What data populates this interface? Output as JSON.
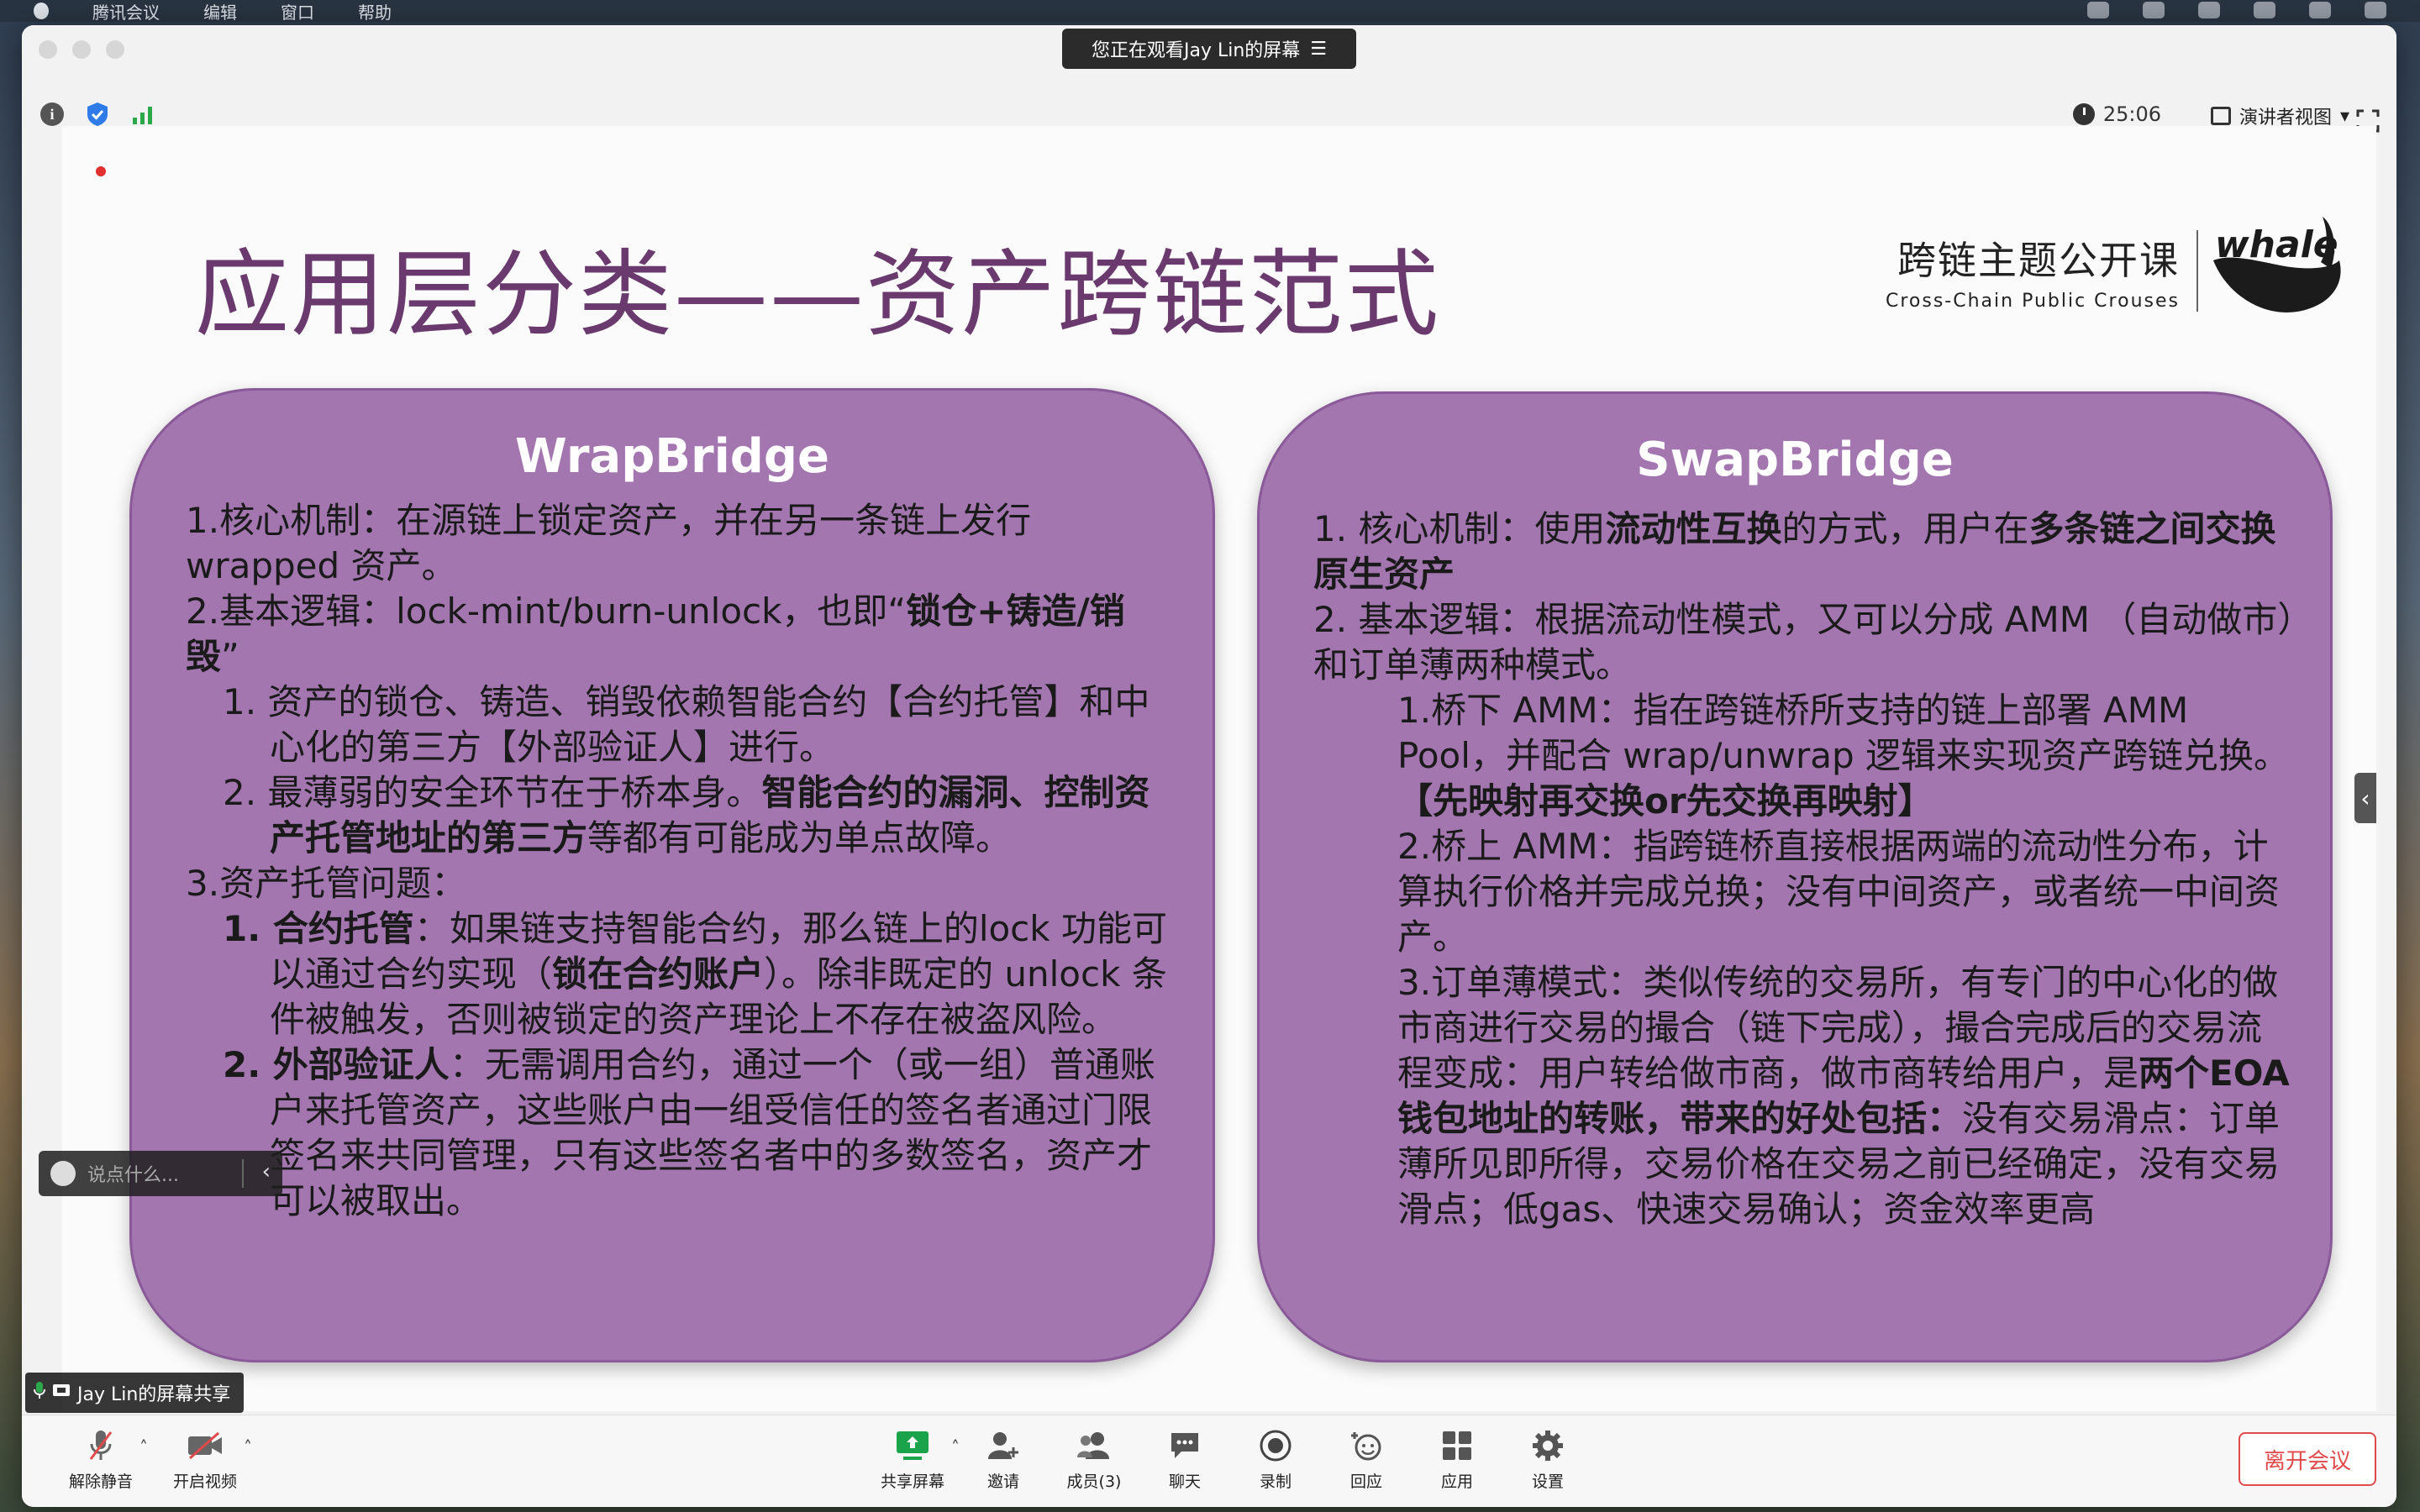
{
  "menubar": {
    "items": [
      "腾讯会议",
      "编辑",
      "窗口",
      "帮助"
    ]
  },
  "titlebar": {
    "watching_label": "您正在观看Jay Lin的屏幕"
  },
  "topbar": {
    "timer": "25:06",
    "view_mode": "演讲者视图"
  },
  "slide": {
    "title": "应用层分类——资产跨链范式",
    "brand_cn": "跨链主题公开课",
    "brand_en": "Cross-Chain Public Crouses",
    "logo_text": "whale",
    "left": {
      "title": "WrapBridge",
      "l1": "1.核心机制：在源链上锁定资产，并在另一条链上发行wrapped 资产。",
      "l2a": "2.基本逻辑：lock-mint/burn-unlock，也即“",
      "l2b": "锁仓+铸造/销毁",
      "l2c": "”",
      "l3": "1.  资产的锁仓、铸造、销毁依赖智能合约【合约托管】和中心化的第三方【外部验证人】进行。",
      "l4a": "2.  最薄弱的安全环节在于桥本身。",
      "l4b": "智能合约的漏洞、控制资产托管地址的第三方",
      "l4c": "等都有可能成为单点故障。",
      "l5": "3.资产托管问题：",
      "l6a": "1.  合约托管",
      "l6b": "：如果链支持智能合约，那么链上的lock 功能可以通过合约实现（",
      "l6c": "锁在合约账户",
      "l6d": "）。除非既定的 unlock 条件被触发，否则被锁定的资产理论上不存在被盗风险。",
      "l7a": "2.  外部验证人",
      "l7b": "：无需调用合约，通过一个（或一组）普通账户来托管资产，这些账户由一组受信任的签名者通过门限签名来共同管理，只有这些签名者中的多数签名，资产才可以被取出。"
    },
    "right": {
      "title": "SwapBridge",
      "r1a": "1. 核心机制：使用",
      "r1b": "流动性互换",
      "r1c": "的方式，用户在",
      "r1d": "多条链之间交换原生资产",
      "r2": "2. 基本逻辑：根据流动性模式，又可以分成 AMM （自动做市）和订单薄两种模式。",
      "r3a": "1.桥下 AMM：指在跨链桥所支持的链上部署 AMM Pool，并配合 wrap/unwrap 逻辑来实现资产跨链兑换。",
      "r3b": "【先映射再交换or先交换再映射】",
      "r4": "2.桥上 AMM：指跨链桥直接根据两端的流动性分布，计算执行价格并完成兑换；没有中间资产，或者统一中间资产。",
      "r5a": "3.订单薄模式：类似传统的交易所，有专门的中心化的做市商进行交易的撮合（链下完成），撮合完成后的交易流程变成：用户转给做市商，做市商转给用户，是",
      "r5b": "两个EOA钱包地址的转账，带来的好处包括：",
      "r5c": "没有交易滑点：订单薄所见即所得，交易价格在交易之前已经确定，没有交易滑点；低gas、快速交易确认；资金效率更高"
    }
  },
  "chat": {
    "placeholder": "说点什么..."
  },
  "share_label": "Jay Lin的屏幕共享",
  "toolbar": {
    "unmute": "解除静音",
    "video": "开启视频",
    "share": "共享屏幕",
    "invite": "邀请",
    "members": "成员(3)",
    "chat": "聊天",
    "record": "录制",
    "react": "回应",
    "apps": "应用",
    "settings": "设置",
    "leave": "离开会议"
  },
  "colors": {
    "panel": "#a376b0",
    "title": "#6a3a6e",
    "share_green": "#1aa34a",
    "leave_red": "#e04a4a"
  }
}
